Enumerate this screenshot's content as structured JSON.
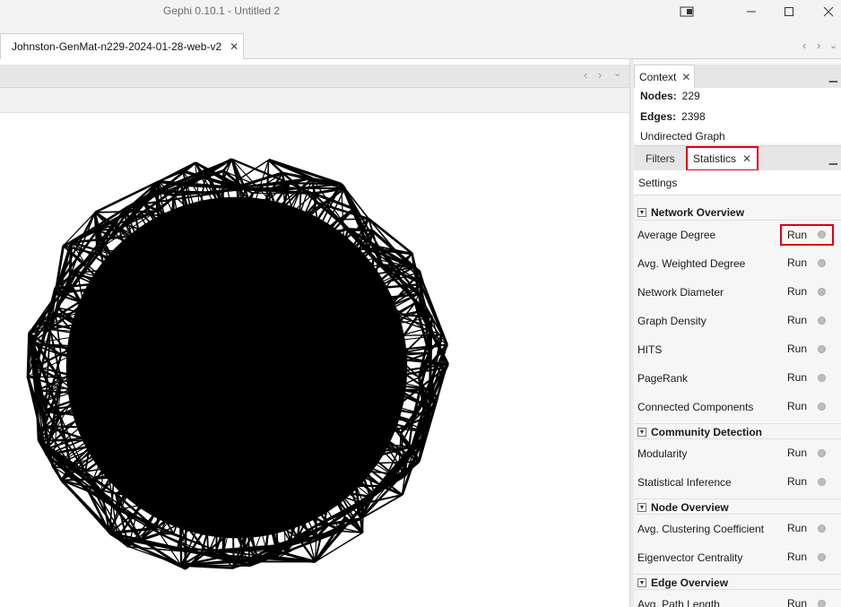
{
  "window": {
    "title": "Gephi 0.10.1 - Untitled 2"
  },
  "document_tab": {
    "label": "Johnston-GenMat-n229-2024-01-28-web-v2",
    "close": "✕"
  },
  "context": {
    "tab_label": "Context",
    "nodes_label": "Nodes:",
    "nodes_value": "229",
    "edges_label": "Edges:",
    "edges_value": "2398",
    "graph_type": "Undirected Graph"
  },
  "panel_tabs": {
    "filters": "Filters",
    "statistics": "Statistics"
  },
  "settings_label": "Settings",
  "run_label": "Run",
  "sections": {
    "network_overview": "Network Overview",
    "community_detection": "Community Detection",
    "node_overview": "Node Overview",
    "edge_overview": "Edge Overview"
  },
  "statistics": {
    "average_degree": "Average Degree",
    "avg_weighted_degree": "Avg. Weighted Degree",
    "network_diameter": "Network Diameter",
    "graph_density": "Graph Density",
    "hits": "HITS",
    "pagerank": "PageRank",
    "connected_components": "Connected Components",
    "modularity": "Modularity",
    "statistical_inference": "Statistical Inference",
    "avg_clustering_coefficient": "Avg. Clustering Coefficient",
    "eigenvector_centrality": "Eigenvector Centrality",
    "avg_path_length": "Avg. Path Length"
  },
  "colors": {
    "highlight": "#d9001b",
    "graph_edges": "#000000"
  }
}
